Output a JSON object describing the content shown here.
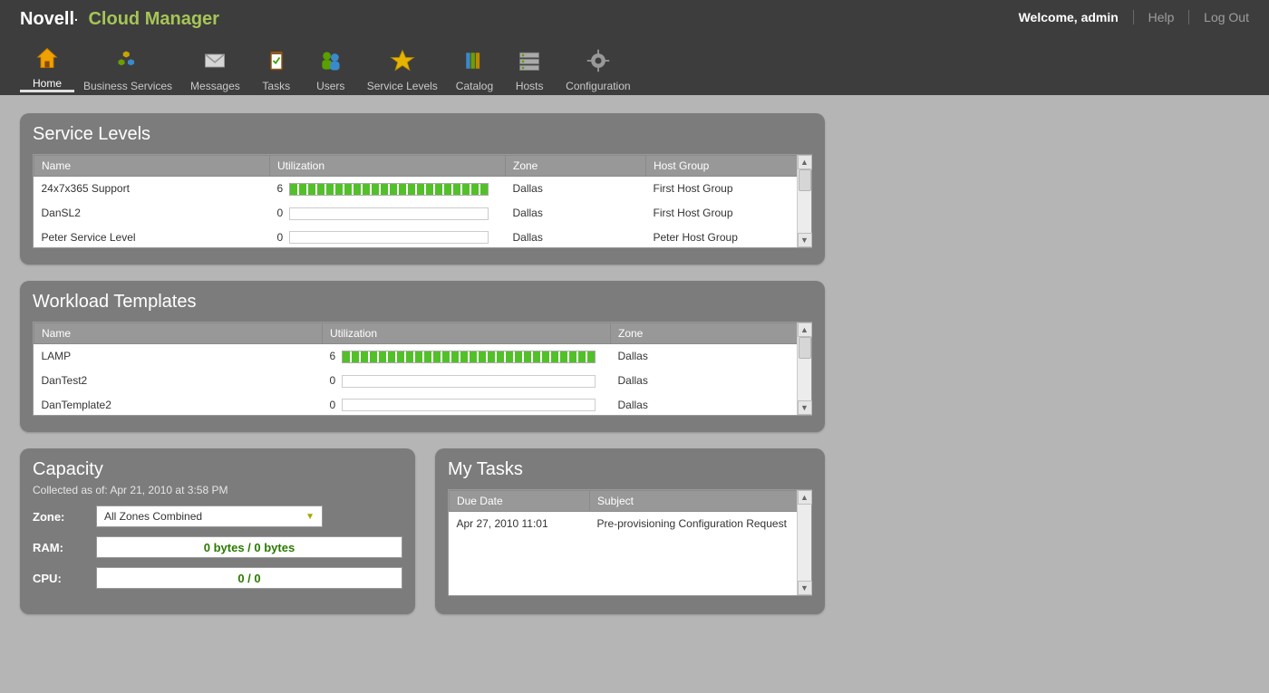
{
  "brand": {
    "part1": "Novell",
    "part2": "Cloud Manager"
  },
  "topRight": {
    "welcome": "Welcome, admin",
    "help": "Help",
    "logout": "Log Out"
  },
  "nav": [
    {
      "label": "Home"
    },
    {
      "label": "Business Services"
    },
    {
      "label": "Messages"
    },
    {
      "label": "Tasks"
    },
    {
      "label": "Users"
    },
    {
      "label": "Service Levels"
    },
    {
      "label": "Catalog"
    },
    {
      "label": "Hosts"
    },
    {
      "label": "Configuration"
    }
  ],
  "serviceLevels": {
    "title": "Service Levels",
    "headers": {
      "name": "Name",
      "utilization": "Utilization",
      "zone": "Zone",
      "hostGroup": "Host Group"
    },
    "rows": [
      {
        "name": "24x7x365 Support",
        "util": "6",
        "full": true,
        "zone": "Dallas",
        "hostGroup": "First Host Group"
      },
      {
        "name": "DanSL2",
        "util": "0",
        "full": false,
        "zone": "Dallas",
        "hostGroup": "First Host Group"
      },
      {
        "name": "Peter Service Level",
        "util": "0",
        "full": false,
        "zone": "Dallas",
        "hostGroup": "Peter Host Group"
      }
    ]
  },
  "workloadTemplates": {
    "title": "Workload Templates",
    "headers": {
      "name": "Name",
      "utilization": "Utilization",
      "zone": "Zone"
    },
    "rows": [
      {
        "name": "LAMP",
        "util": "6",
        "full": true,
        "zone": "Dallas"
      },
      {
        "name": "DanTest2",
        "util": "0",
        "full": false,
        "zone": "Dallas"
      },
      {
        "name": "DanTemplate2",
        "util": "0",
        "full": false,
        "zone": "Dallas"
      }
    ]
  },
  "capacity": {
    "title": "Capacity",
    "collected": "Collected as of: Apr 21, 2010 at 3:58 PM",
    "zoneLabel": "Zone:",
    "zoneValue": "All Zones Combined",
    "ramLabel": "RAM:",
    "ramValue": "0 bytes / 0 bytes",
    "cpuLabel": "CPU:",
    "cpuValue": "0 / 0"
  },
  "myTasks": {
    "title": "My Tasks",
    "headers": {
      "dueDate": "Due Date",
      "subject": "Subject"
    },
    "rows": [
      {
        "dueDate": "Apr 27, 2010 11:01",
        "subject": "Pre-provisioning Configuration Request"
      }
    ]
  }
}
